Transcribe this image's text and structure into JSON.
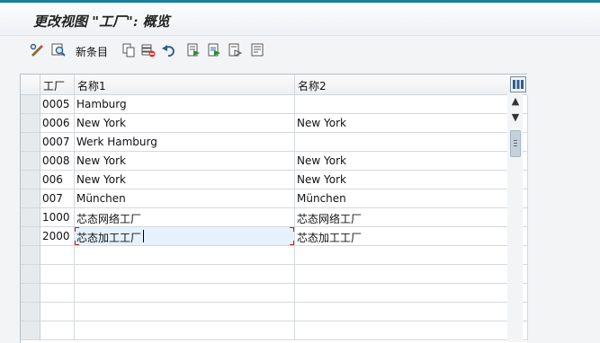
{
  "window": {
    "title": "更改视图 \"工厂\": 概览"
  },
  "toolbar": {
    "buttons": [
      {
        "name": "toggle-display-change-icon"
      },
      {
        "name": "other-view-icon"
      },
      {
        "name": "new-entries-button",
        "label": "新条目"
      },
      {
        "name": "copy-as-icon"
      },
      {
        "name": "delete-icon"
      },
      {
        "name": "undo-change-icon"
      },
      {
        "name": "select-all-icon"
      },
      {
        "name": "select-block-icon"
      },
      {
        "name": "deselect-all-icon"
      },
      {
        "name": "print-icon"
      }
    ]
  },
  "table": {
    "columns": [
      "工厂",
      "名称1",
      "名称2"
    ],
    "rows": [
      {
        "plant": "0005",
        "name1": "Hamburg",
        "name2": ""
      },
      {
        "plant": "0006",
        "name1": "New York",
        "name2": "New York"
      },
      {
        "plant": "0007",
        "name1": "Werk Hamburg",
        "name2": ""
      },
      {
        "plant": "0008",
        "name1": "New York",
        "name2": "New York"
      },
      {
        "plant": "006",
        "name1": "New York",
        "name2": "New York"
      },
      {
        "plant": "007",
        "name1": "München",
        "name2": "München"
      },
      {
        "plant": "1000",
        "name1": "芯态网络工厂",
        "name2": "芯态网络工厂"
      },
      {
        "plant": "2000",
        "name1": "芯态加工工厂",
        "name2": "芯态加工工厂"
      }
    ],
    "empty_rows": 5,
    "active_cell": {
      "row": 7,
      "column": "name1"
    }
  },
  "colors": {
    "accent_line": "#17809a",
    "editing_cell": "#e6f2fb",
    "error_marker": "#c8191e"
  }
}
